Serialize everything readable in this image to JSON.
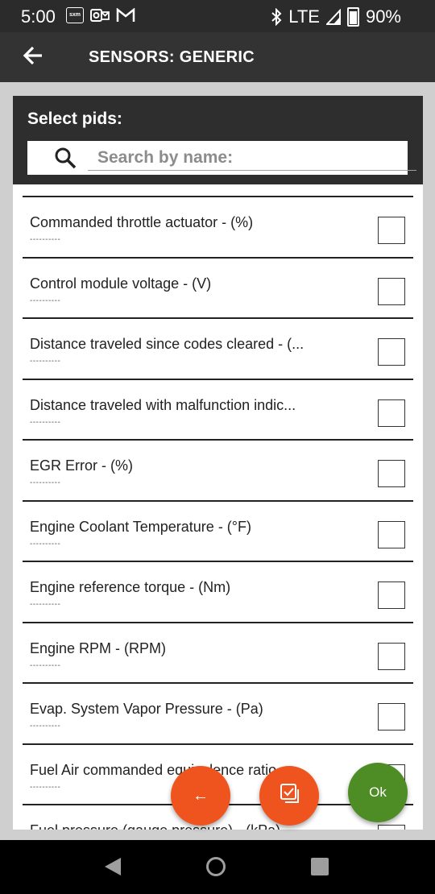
{
  "status_bar": {
    "time": "5:00",
    "left_icons": [
      "sxm-icon",
      "outlook-icon",
      "gmail-icon"
    ],
    "sxm_label": "sxm",
    "network": "LTE",
    "battery": "90%"
  },
  "toolbar": {
    "title": "SENSORS: GENERIC"
  },
  "dialog": {
    "title": "Select pids:",
    "search_placeholder": "Search by name:",
    "items": [
      {
        "name": "Commanded throttle actuator - (%)",
        "value": "----------",
        "checked": false
      },
      {
        "name": "Control module voltage - (V)",
        "value": "----------",
        "checked": false
      },
      {
        "name": "Distance traveled since codes cleared - (...",
        "value": "----------",
        "checked": false
      },
      {
        "name": "Distance traveled with malfunction indic...",
        "value": "----------",
        "checked": false
      },
      {
        "name": "EGR Error - (%)",
        "value": "----------",
        "checked": false
      },
      {
        "name": "Engine Coolant Temperature - (°F)",
        "value": "----------",
        "checked": false
      },
      {
        "name": "Engine reference torque - (Nm)",
        "value": "----------",
        "checked": false
      },
      {
        "name": "Engine RPM - (RPM)",
        "value": "----------",
        "checked": false
      },
      {
        "name": "Evap. System Vapor Pressure - (Pa)",
        "value": "----------",
        "checked": false
      },
      {
        "name": "Fuel Air commanded equivalence ratio",
        "value": "----------",
        "checked": false
      },
      {
        "name": "Fuel pressure (gauge pressure) - (kPa)",
        "value": "----------",
        "checked": false
      }
    ]
  },
  "fabs": {
    "back_label": "←",
    "ok_label": "Ok"
  },
  "colors": {
    "accent_orange": "#f0541e",
    "ok_green": "#4e8c25",
    "header_dark": "#2e2e2e"
  }
}
